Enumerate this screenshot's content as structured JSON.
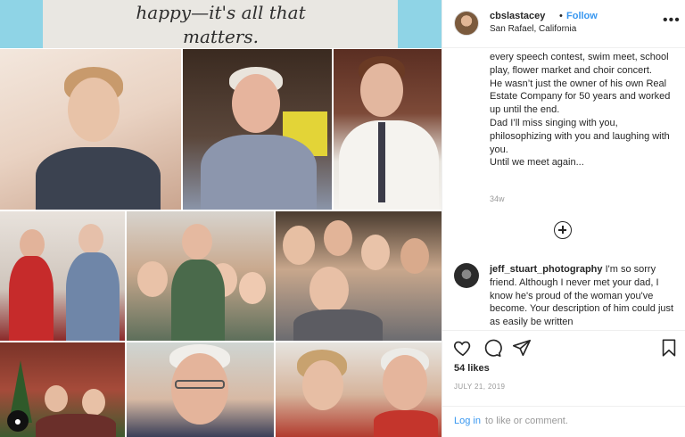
{
  "media": {
    "banner_line1": "happy—it's all that",
    "banner_line2": "matters."
  },
  "post": {
    "username": "cbslastacey",
    "separator": "•",
    "follow_label": "Follow",
    "location": "San Rafael, California",
    "more_icon": "more-horizontal-icon"
  },
  "caption": {
    "lines": [
      "every speech contest, swim meet, school play, flower market and choir concert.",
      "He wasn’t just the owner of his own Real Estate Company for 50 years and worked up until the end.",
      "Dad I’ll miss singing with you, philosophizing with you and laughing with you.",
      "Until we meet again..."
    ],
    "age": "34w"
  },
  "comment": {
    "username": "jeff_stuart_photography",
    "text": "I'm so sorry friend. Although I never met your dad, I know he's proud of the woman you've become. Your description of him could just as easily be written"
  },
  "actions": {
    "likes": "54 likes",
    "date": "JULY 21, 2019",
    "login_link": "Log in",
    "login_rest": "to like or comment."
  },
  "colors": {
    "link_blue": "#3897f0",
    "text": "#262626",
    "muted": "#999999",
    "banner_cyan": "#8fd4e6"
  }
}
